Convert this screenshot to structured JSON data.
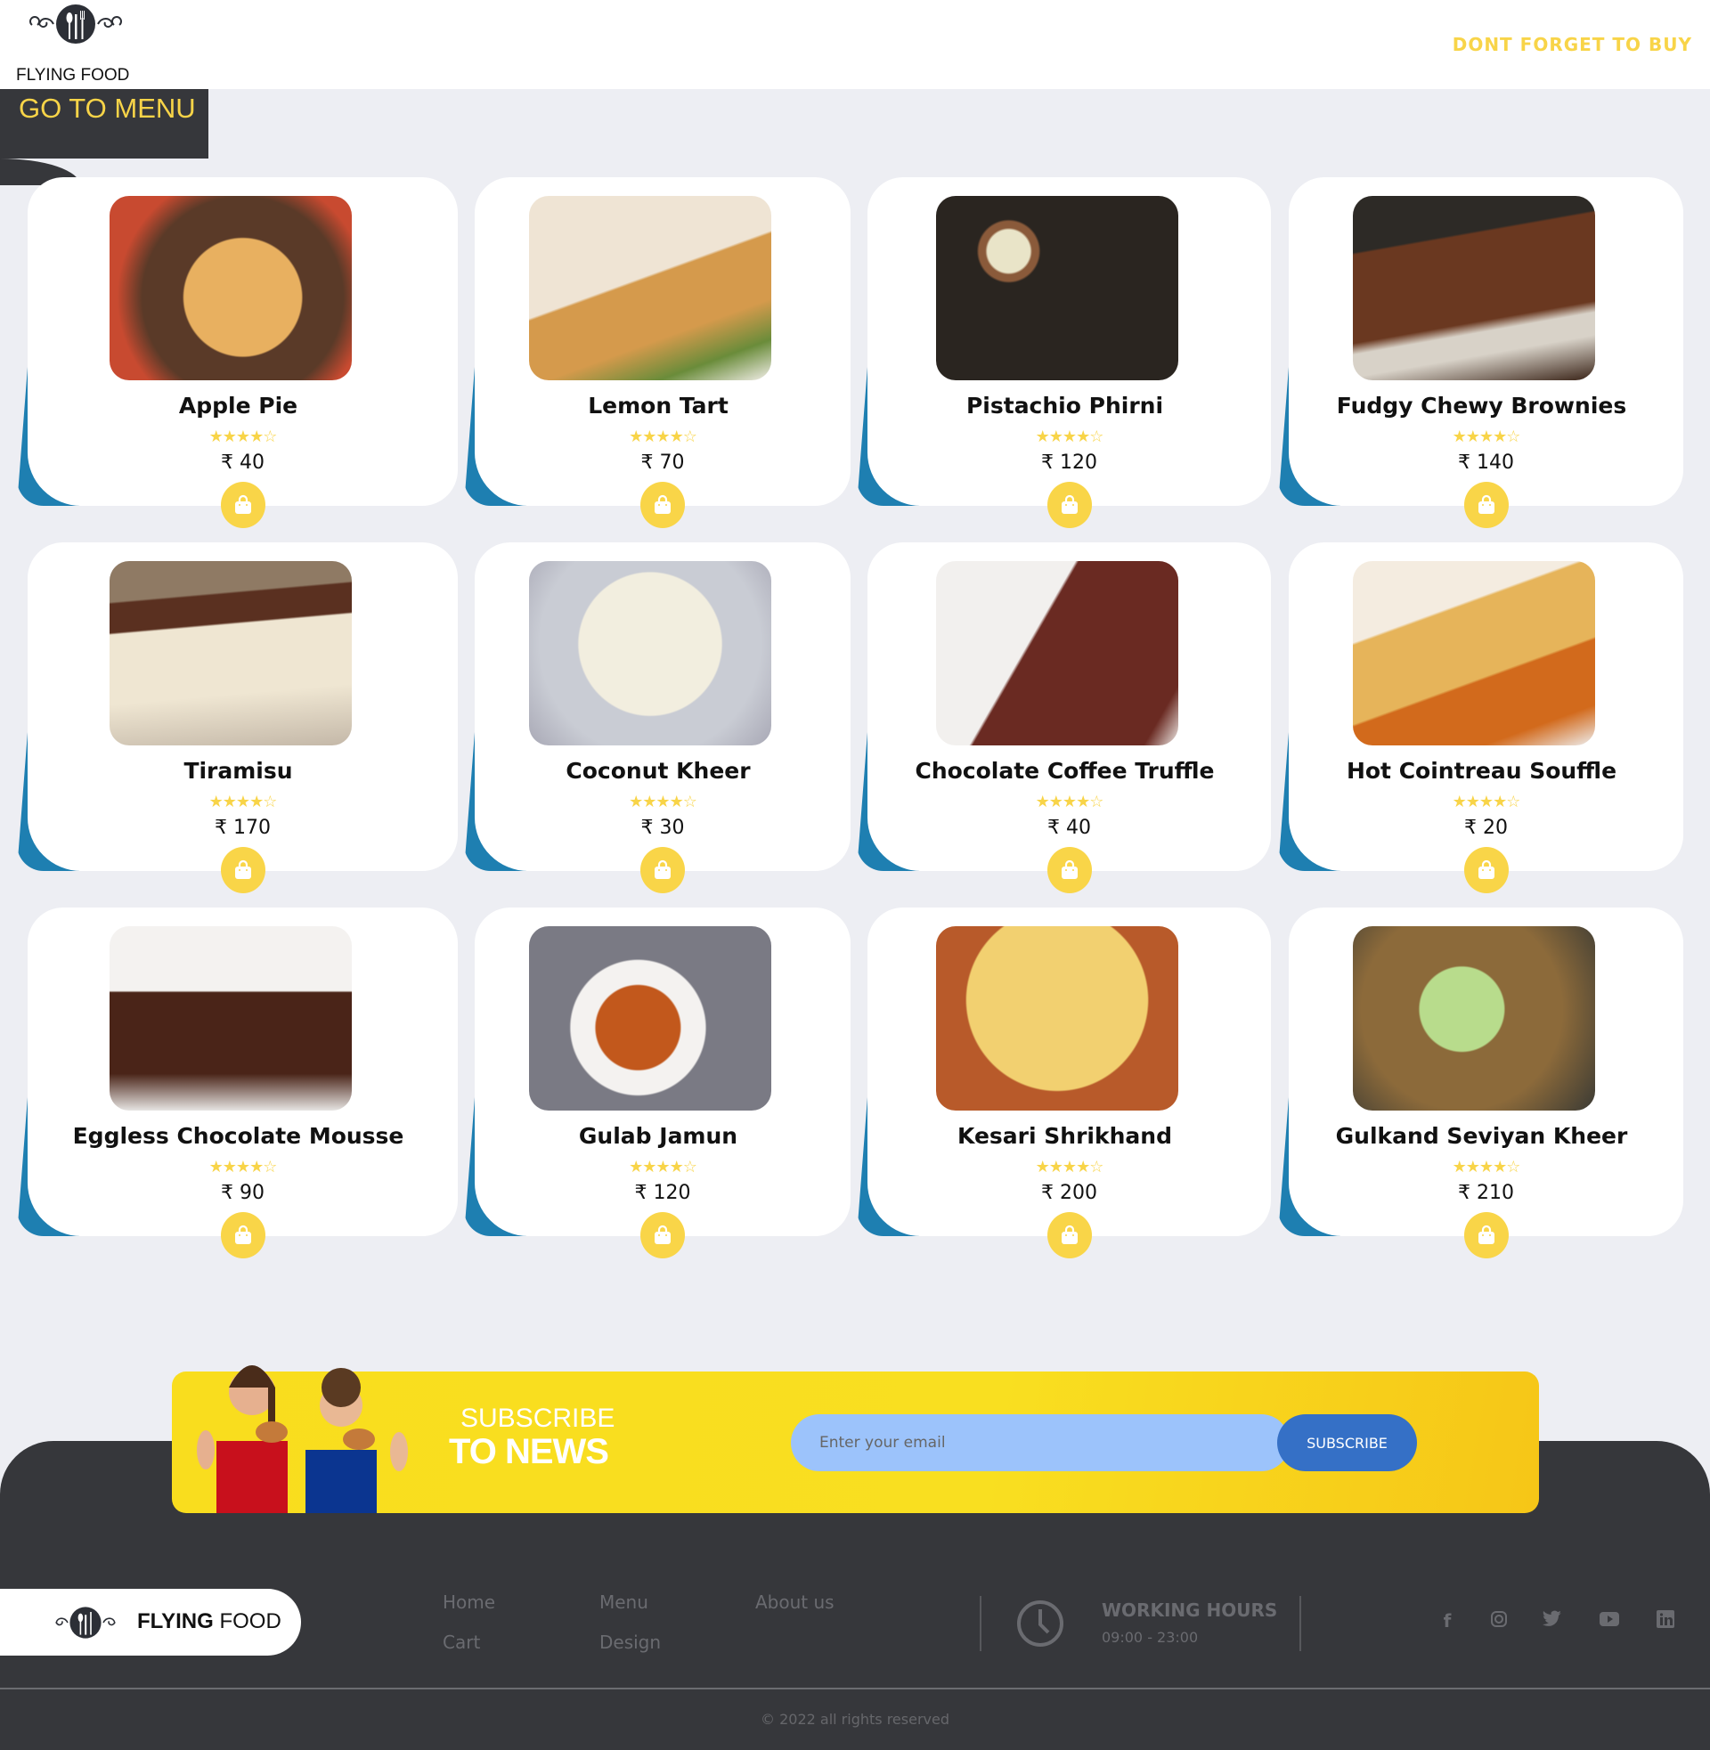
{
  "header": {
    "brand": "FLYING FOOD",
    "tagline": "DONT FORGET TO BUY",
    "go_to_menu": "GO TO MENU"
  },
  "colors": {
    "accent": "#f8d448",
    "dark": "#36373b",
    "blue": "#1e7fb1",
    "button": "#3570c6"
  },
  "products": [
    {
      "name": "Apple Pie",
      "rating": 4,
      "price": "₹ 40"
    },
    {
      "name": "Lemon Tart",
      "rating": 4,
      "price": "₹ 70"
    },
    {
      "name": "Pistachio Phirni",
      "rating": 4,
      "price": "₹ 120"
    },
    {
      "name": "Fudgy Chewy Brownies",
      "rating": 4,
      "price": "₹ 140"
    },
    {
      "name": "Tiramisu",
      "rating": 4,
      "price": "₹ 170"
    },
    {
      "name": "Coconut Kheer",
      "rating": 4,
      "price": "₹ 30"
    },
    {
      "name": "Chocolate Coffee Truffle",
      "rating": 4,
      "price": "₹ 40"
    },
    {
      "name": "Hot Cointreau Souffle",
      "rating": 4,
      "price": "₹ 20"
    },
    {
      "name": "Eggless Chocolate Mousse",
      "rating": 4,
      "price": "₹ 90"
    },
    {
      "name": "Gulab Jamun",
      "rating": 4,
      "price": "₹ 120"
    },
    {
      "name": "Kesari Shrikhand",
      "rating": 4,
      "price": "₹ 200"
    },
    {
      "name": "Gulkand Seviyan Kheer",
      "rating": 4,
      "price": "₹ 210"
    }
  ],
  "subscribe": {
    "line1": "SUBSCRIBE",
    "line2": "TO NEWS",
    "placeholder": "Enter your email",
    "button": "SUBSCRIBE"
  },
  "footer": {
    "brand_bold": "FLYING",
    "brand_light": " FOOD",
    "links": [
      "Home",
      "Menu",
      "About us",
      "Cart",
      "Design"
    ],
    "hours_title": "WORKING HOURS",
    "hours": "09:00 - 23:00",
    "social": [
      "facebook-icon",
      "instagram-icon",
      "twitter-icon",
      "youtube-icon",
      "linkedin-icon"
    ],
    "copyright": "© 2022 all rights reserved"
  }
}
